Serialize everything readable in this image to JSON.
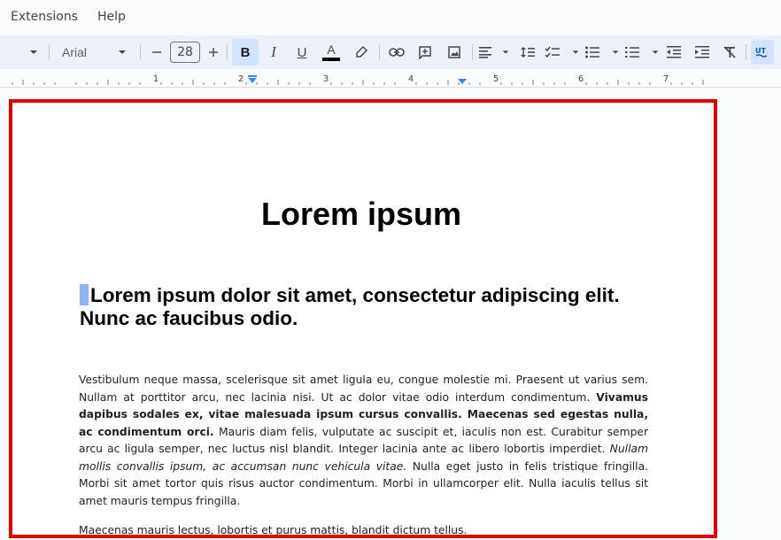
{
  "menu": {
    "items": [
      "Extensions",
      "Help"
    ]
  },
  "toolbar": {
    "font_name": "Arial",
    "font_size": "28",
    "bold_label": "B",
    "italic_label": "I",
    "underline_label": "U",
    "text_color_label": "A",
    "accent": "#0b57d0",
    "active_bg": "#d3e3fd"
  },
  "ruler": {
    "numbers": [
      "1",
      "2",
      "3",
      "4",
      "5",
      "6",
      "7"
    ]
  },
  "document": {
    "title": "Lorem ipsum",
    "heading": "Lorem ipsum dolor sit amet, consectetur adipiscing elit. Nunc ac faucibus odio.",
    "p1": {
      "a": "Vestibulum neque massa, scelerisque sit amet ligula eu, congue molestie mi. Praesent ut varius sem. Nullam at porttitor arcu, nec lacinia nisi. Ut ac dolor vitae odio interdum condimentum. ",
      "bold": "Vivamus dapibus sodales ex, vitae malesuada ipsum cursus convallis. Maecenas sed egestas nulla, ac condimentum orci.",
      "b": " Mauris diam felis, vulputate ac suscipit et, iaculis non est. Curabitur semper arcu ac ligula semper, nec luctus nisl blandit. Integer lacinia ante ac libero lobortis imperdiet. ",
      "italic": "Nullam mollis convallis ipsum, ac accumsan nunc vehicula vitae.",
      "c": " Nulla eget justo in felis tristique fringilla. Morbi sit amet tortor quis risus auctor condimentum. Morbi in ullamcorper elit. Nulla iaculis tellus sit amet mauris tempus fringilla."
    },
    "p2": "Maecenas mauris lectus, lobortis et purus mattis, blandit dictum tellus."
  },
  "annotation_color": "#e30000"
}
